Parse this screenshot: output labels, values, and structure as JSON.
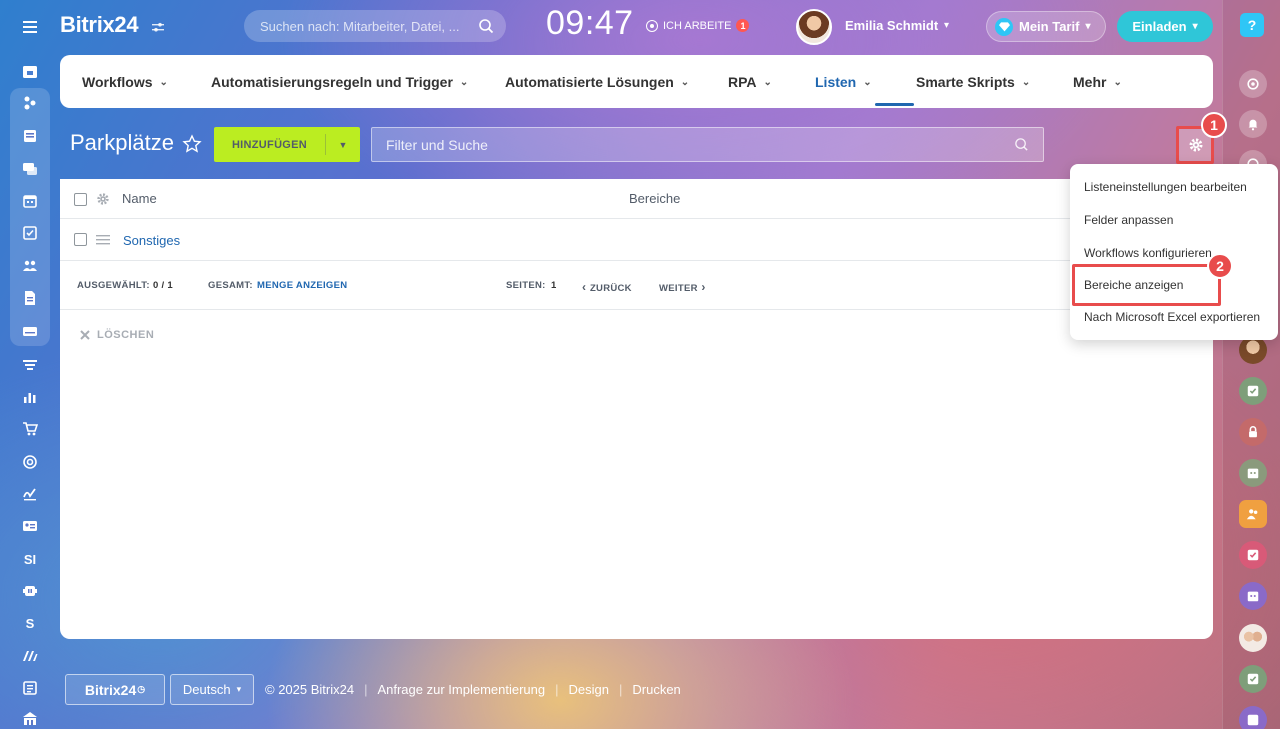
{
  "app": {
    "logo": "Bitrix24",
    "search_placeholder": "Suchen nach: Mitarbeiter, Datei, ...",
    "clock": "09:47",
    "work_status": "ICH ARBEITE",
    "work_badge": "1",
    "user_name": "Emilia Schmidt",
    "tarif_label": "Mein Tarif",
    "invite_label": "Einladen",
    "help_label": "?"
  },
  "leftbar": {
    "text_items": [
      "SI",
      "S"
    ]
  },
  "nav": {
    "tabs": [
      {
        "label": "Workflows"
      },
      {
        "label": "Automatisierungsregeln und Trigger"
      },
      {
        "label": "Automatisierte Lösungen"
      },
      {
        "label": "RPA"
      },
      {
        "label": "Listen"
      },
      {
        "label": "Smarte Skripts"
      },
      {
        "label": "Mehr"
      }
    ],
    "active_tab": "Listen"
  },
  "toolbar": {
    "page_title": "Parkplätze",
    "add_label": "HINZUFÜGEN",
    "filter_placeholder": "Filter und Suche"
  },
  "table": {
    "columns": [
      "Name",
      "Bereiche"
    ],
    "rows": [
      {
        "name": "Sonstiges"
      }
    ]
  },
  "pagination": {
    "selected_label": "AUSGEWÄHLT:",
    "selected_value": "0 / 1",
    "total_label": "GESAMT:",
    "total_link": "MENGE ANZEIGEN",
    "pages_label": "SEITEN:",
    "pages_value": "1",
    "prev_label": "ZURÜCK",
    "next_label": "WEITER"
  },
  "actions": {
    "delete_label": "LÖSCHEN"
  },
  "dropdown": {
    "items": [
      "Listeneinstellungen bearbeiten",
      "Felder anpassen",
      "Workflows konfigurieren",
      "Bereiche anzeigen",
      "Nach Microsoft Excel exportieren"
    ]
  },
  "markers": [
    "1",
    "2"
  ],
  "footer": {
    "brand_button": "Bitrix24",
    "language": "Deutsch",
    "copyright": "© 2025 Bitrix24",
    "links": [
      "Anfrage zur Implementierung",
      "Design",
      "Drucken"
    ]
  },
  "colors": {
    "accent_blue": "#2067b0",
    "add_button": "#bbed21",
    "invite_button": "#2fc6d8",
    "annotation_red": "#e84c4c"
  }
}
